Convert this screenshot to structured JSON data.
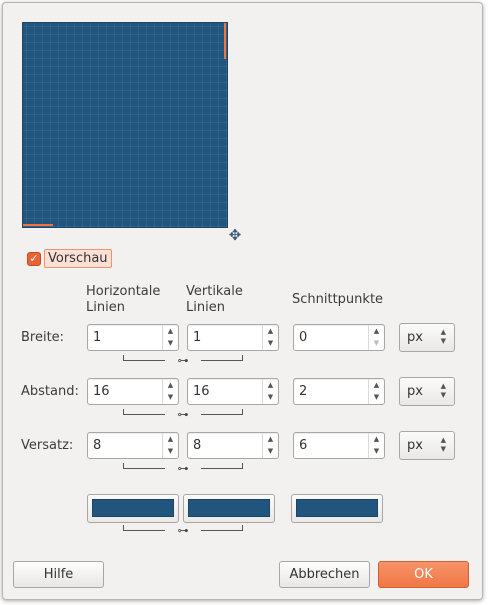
{
  "preview": {
    "color": "#22557e",
    "handle_color": "#f07240",
    "move_icon": "move-cross-icon"
  },
  "preview_toggle": {
    "label": "Vorschau",
    "checked": true
  },
  "columns": {
    "horizontal": "Horizontale\nLinien",
    "vertical": "Vertikale\nLinien",
    "intersections": "Schnittpunkte"
  },
  "rows": [
    {
      "label": "Breite:",
      "horizontal": "1",
      "vertical": "1",
      "intersections": "0",
      "unit": "px"
    },
    {
      "label": "Abstand:",
      "horizontal": "16",
      "vertical": "16",
      "intersections": "2",
      "unit": "px"
    },
    {
      "label": "Versatz:",
      "horizontal": "8",
      "vertical": "8",
      "intersections": "6",
      "unit": "px"
    }
  ],
  "colors": {
    "horizontal": "#22557e",
    "vertical": "#22557e",
    "intersections": "#22557e"
  },
  "icons": {
    "chain": "chain-link-icon",
    "spin_up": "arrow-up-icon",
    "spin_down": "arrow-down-icon"
  },
  "buttons": {
    "help": "Hilfe",
    "cancel": "Abbrechen",
    "ok": "OK"
  }
}
